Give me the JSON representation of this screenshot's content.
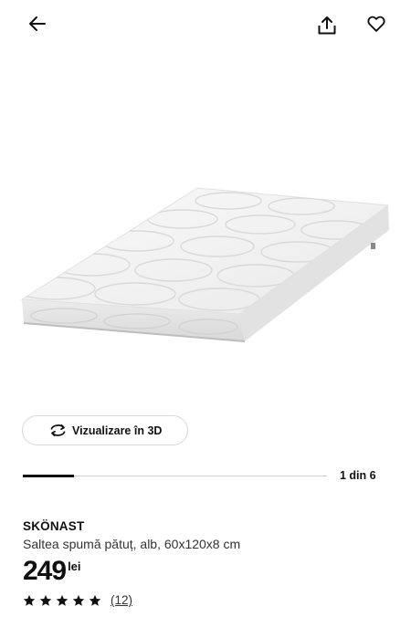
{
  "header": {
    "back_icon": "arrow-left-icon",
    "share_icon": "share-icon",
    "favorite_icon": "heart-icon"
  },
  "gallery": {
    "view_3d_label": "Vizualizare în 3D",
    "view_3d_icon": "rotate-3d-icon",
    "counter": "1 din 6",
    "current_image": 1,
    "total_images": 6
  },
  "product": {
    "name": "SKÖNAST",
    "description": "Saltea spumă pătuț, alb, 60x120x8 cm",
    "price": "249",
    "currency": "lei",
    "rating": 5,
    "reviews_label": "(12)"
  },
  "colors": {
    "text": "#111111",
    "border": "#d7d7d7",
    "accent": "#111111"
  }
}
